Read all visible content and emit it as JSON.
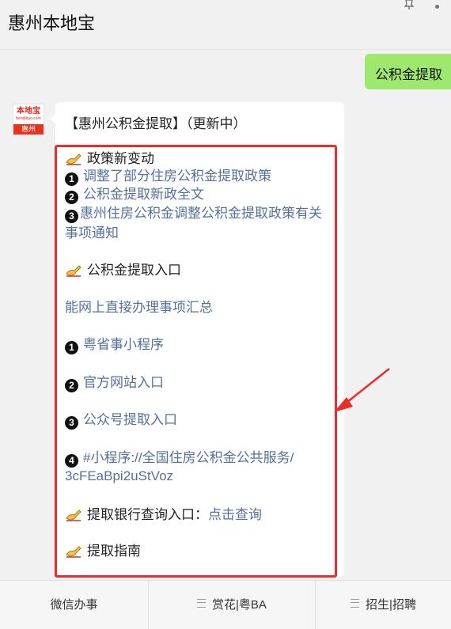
{
  "header": {
    "title": "惠州本地宝"
  },
  "chat": {
    "user_message": "公积金提取",
    "avatar": {
      "logo_text": "本地宝",
      "logo_sub": "bendibao.com",
      "city": "惠州"
    },
    "reply": {
      "title": "【惠州公积金提取】（更新中）",
      "section1_heading": "政策新变动",
      "item1_num": "1",
      "item1": "调整了部分住房公积金提取政策",
      "item2_num": "2",
      "item2": "公积金提取新政全文",
      "item3_num": "3",
      "item3_line1": "惠州住房公积金调整公积金提取政策有关",
      "item3_line2": "事项通知",
      "section2_heading": "公积金提取入口",
      "online_link": "能网上直接办理事项汇总",
      "entry1_num": "1",
      "entry1": "粤省事小程序",
      "entry2_num": "2",
      "entry2": "官方网站入口",
      "entry3_num": "3",
      "entry3": "公众号提取入口",
      "entry4_num": "4",
      "entry4_line1": "#小程序://全国住房公积金公共服务/",
      "entry4_line2": "3cFEaBpi2uStVoz",
      "bank_label": "提取银行查询入口：",
      "bank_link": "点击查询",
      "guide": "提取指南"
    }
  },
  "bottom_tabs": [
    "微信办事",
    "赏花|粤BA",
    "招生|招聘"
  ],
  "colors": {
    "user_bubble": "#9fe870",
    "link": "#55709a",
    "highlight": "#ee2a2a",
    "background": "#f1f1f1"
  }
}
